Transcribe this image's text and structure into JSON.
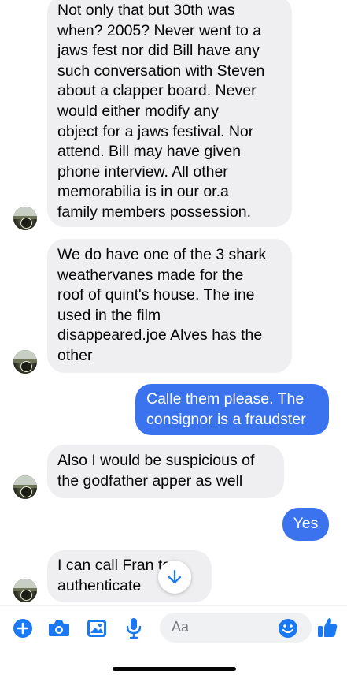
{
  "messages": [
    {
      "direction": "incoming",
      "lines": [
        "Not only that but 30th was",
        "when? 2005? Never went to a",
        "jaws fest nor did Bill have any",
        "such conversation with Steven",
        "about a clapper board. Never",
        "would either modify any",
        "object for a jaws festival. Nor",
        "attend.  Bill may have given",
        "phone interview.  All other",
        "memorabilia is in our or.a",
        "family members possession."
      ]
    },
    {
      "direction": "incoming",
      "lines": [
        "We do have one of the 3 shark",
        "weathervanes made for the",
        "roof of quint's house. The ine",
        "used in the film",
        "disappeared.joe Alves has the",
        "other"
      ]
    },
    {
      "direction": "outgoing",
      "lines": [
        "Calle them please. The",
        "consignor is a fraudster"
      ]
    },
    {
      "direction": "incoming",
      "lines": [
        "Also I would be suspicious of",
        "the godfather apper as well"
      ]
    },
    {
      "direction": "outgoing",
      "lines": [
        "Yes"
      ]
    },
    {
      "direction": "incoming",
      "lines": [
        "I can call Fran    to",
        "authenticate"
      ]
    }
  ],
  "composer": {
    "placeholder": "Aa"
  },
  "icons": {
    "add": "plus-circle-icon",
    "camera": "camera-icon",
    "gallery": "image-icon",
    "voice": "microphone-icon",
    "emoji": "emoji-icon",
    "like": "thumbs-up-icon",
    "scroll": "arrow-down-icon"
  },
  "colors": {
    "accent": "#3b73ee",
    "incoming_bubble": "#efeff1",
    "icon_blue": "#1a78f2"
  }
}
